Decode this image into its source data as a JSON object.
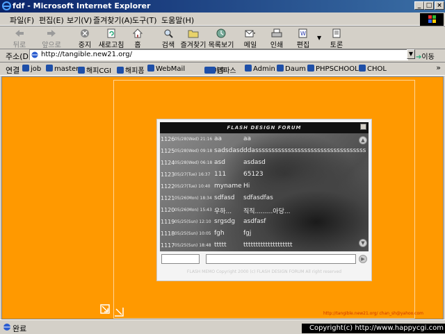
{
  "window": {
    "title": "fdf - Microsoft Internet Explorer"
  },
  "menu": [
    "파일(F)",
    "편집(E)",
    "보기(V)",
    "즐겨찾기(A)",
    "도구(T)",
    "도움말(H)"
  ],
  "toolbar": {
    "back": "뒤로",
    "forward": "앞으로",
    "stop": "중지",
    "refresh": "새로고침",
    "home": "홈",
    "search": "검색",
    "favorites": "즐겨찾기",
    "history": "목록보기",
    "mail": "메일",
    "print": "인쇄",
    "edit": "편집",
    "discuss": "토론"
  },
  "address": {
    "label": "주소(D)",
    "url": "http://tangible.new21.org/",
    "go": "이동"
  },
  "links": {
    "label": "연결",
    "items": [
      "job",
      "master",
      "해피CGI",
      "해피폼",
      "WebMail",
      "야후",
      "엠파스",
      "Admin",
      "Daum",
      "PHPSCHOOL",
      "CHOL"
    ]
  },
  "forum": {
    "title": "FLASH DESIGN FORUM",
    "rows": [
      {
        "no": "1126",
        "date": "05/28(Wed) 21:16",
        "name": "aa",
        "msg": "aa"
      },
      {
        "no": "1125",
        "date": "05/28(Wed) 09:18",
        "name": "sadsdasd",
        "msg": "ddassssssssssssssssssssssssssssssssss"
      },
      {
        "no": "1124",
        "date": "05/28(Wed) 06:18",
        "name": "asd",
        "msg": "asdasd"
      },
      {
        "no": "1123",
        "date": "05/27(Tue) 16:37",
        "name": "111",
        "msg": "65123"
      },
      {
        "no": "1122",
        "date": "05/27(Tue) 10:40",
        "name": "myname",
        "msg": "Hi"
      },
      {
        "no": "1121",
        "date": "05/26(Mon) 18:34",
        "name": "sdfasd",
        "msg": "sdfasdfas"
      },
      {
        "no": "1120",
        "date": "05/26(Mon) 15:43",
        "name": "우하...",
        "msg": "직직.........아당..."
      },
      {
        "no": "1119",
        "date": "05/25(Sun) 12:10",
        "name": "srgsdg",
        "msg": "asdfasf"
      },
      {
        "no": "1118",
        "date": "05/25(Sun) 10:05",
        "name": "fgh",
        "msg": "fgj"
      },
      {
        "no": "1117",
        "date": "05/25(Sun) 18:48",
        "name": "ttttt",
        "msg": "tttttttttttttttttttt"
      }
    ],
    "copyright": "FLASH MEMO  Copyright 2000 (c) FLASH DESIGN FORUM All right reserved"
  },
  "corner_url": "http://tangible.new21.org/ chan_sh@yahoo.com",
  "status": {
    "text": "완료"
  },
  "overlay": "Copyright(c) http://www.happycgi.com"
}
